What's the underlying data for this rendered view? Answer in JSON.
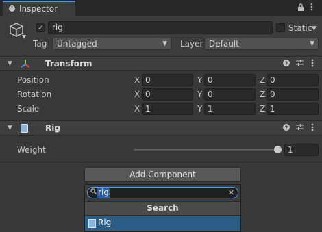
{
  "tab": {
    "title": "Inspector",
    "icon": "info-icon"
  },
  "tab_controls": {
    "lock_icon": "lock-icon",
    "menu_icon": "kebab-menu-icon"
  },
  "gameobject": {
    "active_checked": true,
    "name": "rig",
    "static_label": "Static",
    "tag_label": "Tag",
    "tag_value": "Untagged",
    "layer_label": "Layer",
    "layer_value": "Default"
  },
  "transform": {
    "title": "Transform",
    "rows": [
      {
        "label": "Position",
        "x": "0",
        "y": "0",
        "z": "0"
      },
      {
        "label": "Rotation",
        "x": "0",
        "y": "0",
        "z": "0"
      },
      {
        "label": "Scale",
        "x": "1",
        "y": "1",
        "z": "1"
      }
    ],
    "axes": [
      "X",
      "Y",
      "Z"
    ]
  },
  "rig": {
    "title": "Rig",
    "weight_label": "Weight",
    "weight_value": "1",
    "weight_fraction": 1.0
  },
  "add_component": {
    "button_label": "Add Component",
    "search_value": "rig",
    "section_label": "Search",
    "results": [
      {
        "label": "Rig",
        "selected": true
      }
    ]
  },
  "colors": {
    "accent": "#4e9cf5",
    "selection": "#2c5d87"
  }
}
